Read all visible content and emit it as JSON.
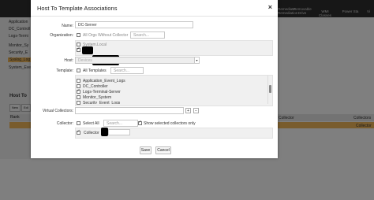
{
  "background": {
    "columns": [
      "Remediate",
      "Remediation",
      "Removable Drive",
      "WMI Classes",
      "Power Sta",
      "Vi"
    ],
    "left_rows": [
      "Application",
      "DC_Controll",
      "Logs-Termi",
      "Monitor_Sy",
      "Security_E",
      "Syslog_Log",
      "System_Eve"
    ],
    "section_title": "Host To",
    "tabs": [
      "New",
      "Edi"
    ],
    "table_header": "Rank",
    "right_header": "Collector",
    "right_header2": "Collectors",
    "right_row": "Collector"
  },
  "dialog": {
    "title": "Host To Template Associations",
    "close": "×",
    "name_label": "Name:",
    "name_value": "DC-Server",
    "org_label": "Organization:",
    "all_orgs_label": "All Orgs Without Collector",
    "org_search_placeholder": "Search...",
    "org_items": [
      "System.Local",
      ""
    ],
    "host_label": "Host:",
    "host_value": "Devices",
    "template_label": "Template:",
    "all_templates_label": "All Templates",
    "template_search_placeholder": "Search...",
    "templates": [
      {
        "label": "Application_Event_Logs",
        "checked": false
      },
      {
        "label": "DC_Controller",
        "checked": false
      },
      {
        "label": "Logs-Terminal-Server",
        "checked": true
      },
      {
        "label": "Monitor_System",
        "checked": false
      },
      {
        "label": "Security_Event_Logs",
        "checked": false
      }
    ],
    "virtual_collectors_label": "Virtual Collectors:",
    "add_icon": "+",
    "remove_icon": "−",
    "collector_label": "Collector:",
    "select_all_label": "Select All",
    "collector_search_placeholder": "Search...",
    "show_selected_label": "Show selected collectors only",
    "collector_item": "Collector",
    "save_label": "Save",
    "cancel_label": "Cancel"
  }
}
